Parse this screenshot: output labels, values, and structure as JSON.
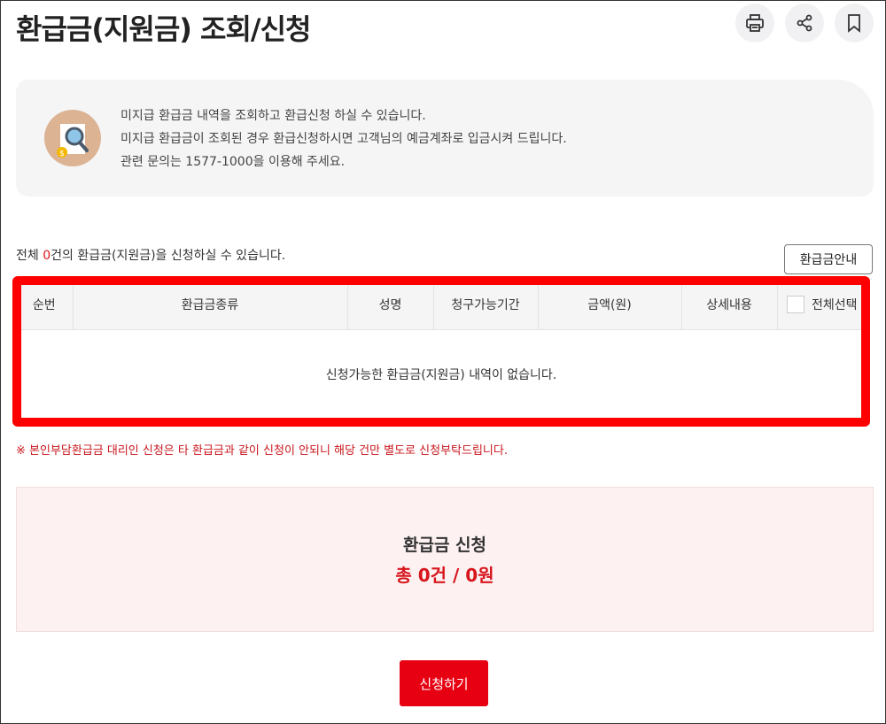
{
  "header": {
    "title": "환급금(지원금) 조회/신청",
    "tools": [
      {
        "name": "print-icon"
      },
      {
        "name": "share-icon"
      },
      {
        "name": "bookmark-icon"
      }
    ]
  },
  "info": {
    "icon": "search-document-icon",
    "lines": [
      "미지급 환급금 내역을 조회하고 환급신청 하실 수 있습니다.",
      "미지급 환급금이 조회된 경우 환급신청하시면 고객님의 예금계좌로 입금시켜 드립니다.",
      "관련 문의는 1577-1000을 이용해 주세요."
    ]
  },
  "summary": {
    "prefix": "전체 ",
    "count": "0",
    "suffix": "건의 환급금(지원금)을 신청하실 수 있습니다.",
    "guide_button": "환급금안내"
  },
  "table": {
    "columns": [
      "순번",
      "환급금종류",
      "성명",
      "청구가능기간",
      "금액(원)",
      "상세내용",
      "전체선택"
    ],
    "empty_message": "신청가능한 환급금(지원금) 내역이 없습니다."
  },
  "notice": "※ 본인부담환급금 대리인 신청은 타 환급금과 같이 신청이 안되니 해당 건만 별도로 신청부탁드립니다.",
  "apply": {
    "title": "환급금 신청",
    "total": "총 0건 / 0원"
  },
  "submit_button": "신청하기",
  "colors": {
    "accent": "#e60012",
    "highlight": "#ff0000"
  }
}
